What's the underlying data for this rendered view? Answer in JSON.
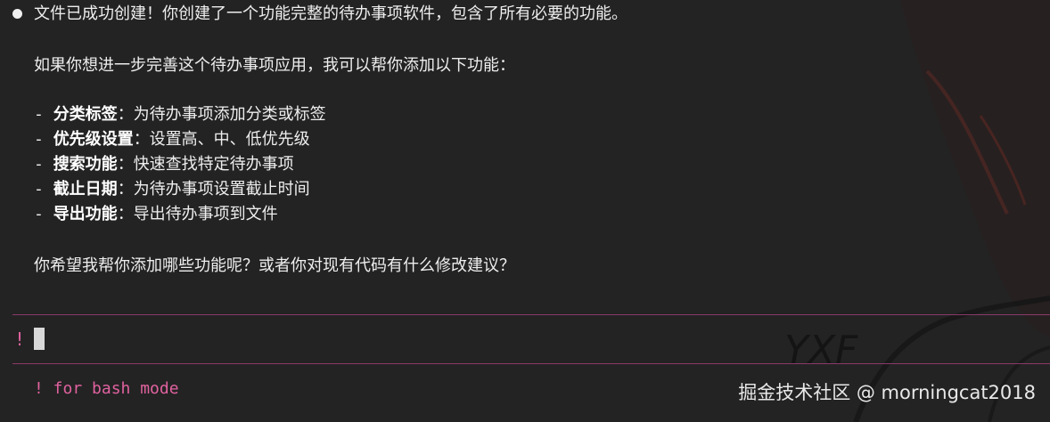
{
  "message": {
    "line1": "文件已成功创建！你创建了一个功能完整的待办事项软件，包含了所有必要的功能。",
    "line2": "如果你想进一步完善这个待办事项应用，我可以帮你添加以下功能：",
    "features": [
      {
        "prefix": "- ",
        "title": "分类标签",
        "desc": "：为待办事项添加分类或标签"
      },
      {
        "prefix": "- ",
        "title": "优先级设置",
        "desc": "：设置高、中、低优先级"
      },
      {
        "prefix": "- ",
        "title": "搜索功能",
        "desc": "：快速查找特定待办事项"
      },
      {
        "prefix": "- ",
        "title": "截止日期",
        "desc": "：为待办事项设置截止时间"
      },
      {
        "prefix": "- ",
        "title": "导出功能",
        "desc": "：导出待办事项到文件"
      }
    ],
    "question": "你希望我帮你添加哪些功能呢？或者你对现有代码有什么修改建议？"
  },
  "input": {
    "prompt_symbol": "!",
    "value": ""
  },
  "hint": "! for bash mode",
  "watermark": "掘金技术社区 @ morningcat2018",
  "art_signature": "YXF",
  "colors": {
    "background": "#232323",
    "accent": "#e0629f",
    "rule": "#8a3a6a",
    "text": "#eeeeee"
  }
}
